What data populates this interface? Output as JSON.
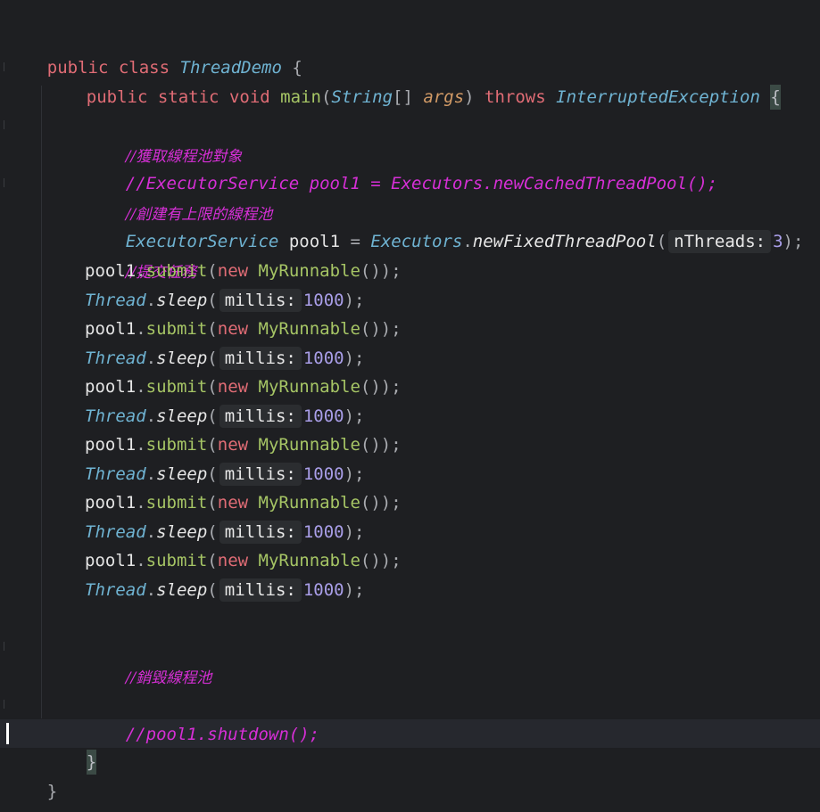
{
  "editor": {
    "lines": {
      "l1": {
        "kw1": "public",
        "kw2": "class",
        "name": "ThreadDemo",
        "brace": "{"
      },
      "l2": {
        "kw1": "public",
        "kw2": "static",
        "kw3": "void",
        "method": "main",
        "open": "(",
        "type": "String",
        "arr": "[]",
        "param": "args",
        "close": ")",
        "throws": "throws",
        "exc": "InterruptedException",
        "brace": "{"
      },
      "c1": "//獲取線程池對象",
      "c2": "//ExecutorService pool1 = Executors.newCachedThreadPool();",
      "c3": "//創建有上限的線程池",
      "l6": {
        "type": "ExecutorService",
        "var": "pool1",
        "eq": "=",
        "cls": "Executors",
        "dot": ".",
        "method": "newFixedThreadPool",
        "open": "(",
        "hint": "nThreads:",
        "num": "3",
        "close": ");"
      },
      "c4": "//提交任務",
      "submit": {
        "var": "pool1",
        "dot": ".",
        "method": "submit",
        "open": "(",
        "new": "new",
        "cls": "MyRunnable",
        "close": "());"
      },
      "sleep": {
        "cls": "Thread",
        "dot": ".",
        "method": "sleep",
        "open": "(",
        "hint": "millis:",
        "num": "1000",
        "close": ");"
      },
      "c5": "//銷毀線程池",
      "c6": "//pool1.shutdown();",
      "close_inner": "}",
      "close_outer": "}"
    }
  }
}
